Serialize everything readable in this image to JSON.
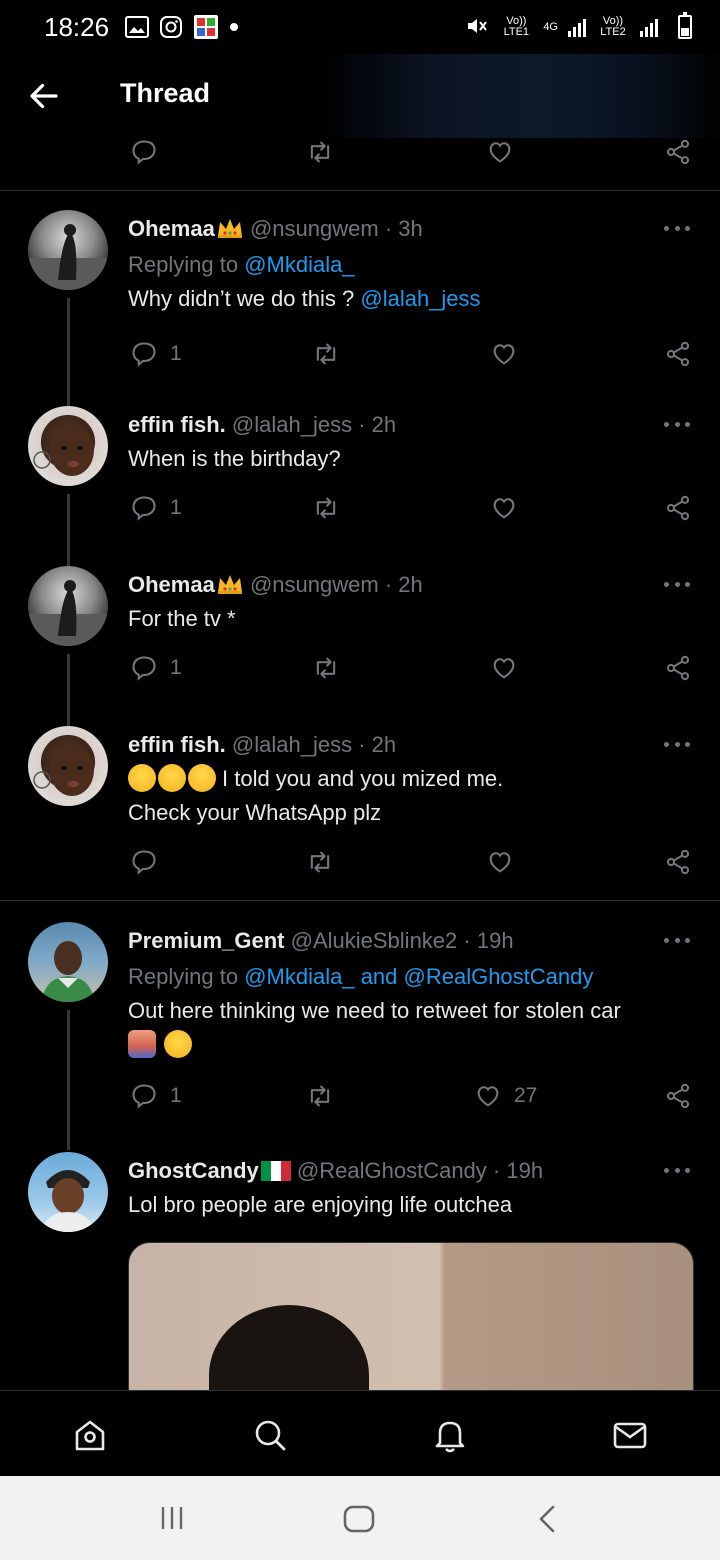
{
  "status_bar": {
    "time": "18:26",
    "sim1": "Vo)) LTE1",
    "network": "4G",
    "sim2": "Vo)) LTE2"
  },
  "header": {
    "title": "Thread"
  },
  "tweets": [
    {
      "name": "Ohemaa",
      "handle": "@nsungwem",
      "time": "· 3h",
      "replying_prefix": "Replying to",
      "replying_to": "@Mkdiala_",
      "text": "Why didn’t we do this ?",
      "mention": "@lalah_jess",
      "replies": "1"
    },
    {
      "name": "effin fish.",
      "handle": "@lalah_jess",
      "time": "· 2h",
      "text": "When is the birthday?",
      "replies": "1"
    },
    {
      "name": "Ohemaa",
      "handle": "@nsungwem",
      "time": "· 2h",
      "text": "For the tv *",
      "replies": "1"
    },
    {
      "name": "effin fish.",
      "handle": "@lalah_jess",
      "time": "· 2h",
      "text_line1": "I told you and you mized me.",
      "text_line2": "Check your WhatsApp plz"
    },
    {
      "name": "Premium_Gent",
      "handle": "@AlukieSblinke2",
      "time": "· 19h",
      "replying_prefix": "Replying to",
      "replying_to": "@Mkdiala_ and @RealGhostCandy",
      "text": "Out here thinking we need to retweet for stolen car",
      "replies": "1",
      "likes": "27"
    },
    {
      "name": "GhostCandy",
      "handle": "@RealGhostCandy",
      "time": "· 19h",
      "text": "Lol bro people are enjoying life outchea"
    }
  ],
  "icons": {
    "back": "arrow-left-icon",
    "reply": "speech-bubble-icon",
    "retweet": "retweet-icon",
    "like": "heart-icon",
    "share": "share-icon",
    "more": "more-dots-icon",
    "nav": [
      "home-icon",
      "search-icon",
      "bell-icon",
      "mail-icon"
    ],
    "system": [
      "recents-icon",
      "home-button-icon",
      "back-icon"
    ]
  },
  "colors": {
    "background": "#000000",
    "link": "#1d9bf0",
    "secondary_text": "#71767b",
    "primary_text": "#e7e9ea"
  }
}
